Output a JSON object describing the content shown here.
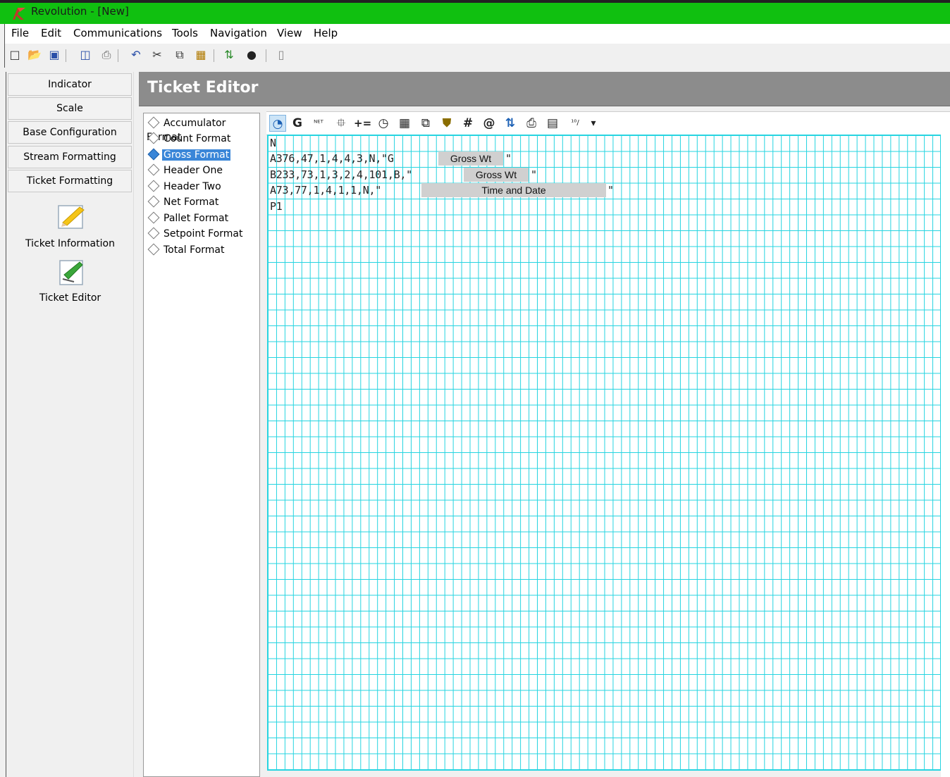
{
  "window": {
    "title": "Revolution - [New]",
    "accent_color": "#10c010"
  },
  "menu": [
    "File",
    "Edit",
    "Communications",
    "Tools",
    "Navigation",
    "View",
    "Help"
  ],
  "toolbar_icons": [
    "new-icon",
    "open-icon",
    "save-icon",
    "print-preview-icon",
    "print-icon",
    "undo-icon",
    "cut-icon",
    "copy-icon",
    "paste-icon",
    "connect-icon",
    "disconnect-icon",
    "comment-icon"
  ],
  "nav": {
    "buttons": [
      "Indicator",
      "Scale",
      "Base Configuration",
      "Stream Formatting",
      "Ticket Formatting"
    ],
    "panel_items": [
      "Ticket Information",
      "Ticket Editor"
    ]
  },
  "header": {
    "title": "Ticket Editor"
  },
  "tree": {
    "items": [
      "Accumulator Format",
      "Count Format",
      "Gross Format",
      "Header One",
      "Header Two",
      "Net Format",
      "Pallet Format",
      "Setpoint Format",
      "Total Format"
    ],
    "selected": "Gross Format"
  },
  "editor_toolbar": {
    "glyphs": [
      "◔",
      "G",
      "ᴺᴱᵀ",
      "⯐",
      "+=",
      "◷",
      "▦",
      "⧉",
      "⛊",
      "#",
      "@",
      "⇅",
      "⎙",
      "▤",
      "¹⁰/",
      "▾"
    ]
  },
  "editor": {
    "lines": [
      {
        "text": "N"
      },
      {
        "text": "A376,47,1,4,4,3,N,\"G",
        "field": "Gross Wt",
        "tail": "\""
      },
      {
        "text": "B233,73,1,3,2,4,101,B,\"",
        "field": "Gross Wt",
        "tail": "\""
      },
      {
        "text": "A73,77,1,4,1,1,N,\"",
        "field": "Time and Date",
        "tail": "\""
      },
      {
        "text": "P1"
      }
    ]
  }
}
